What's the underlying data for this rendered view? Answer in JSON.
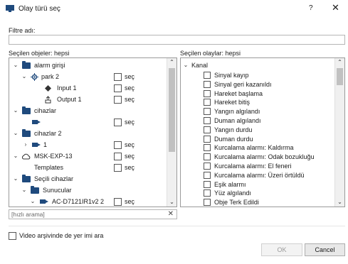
{
  "window": {
    "title": "Olay türü seç",
    "help": "?",
    "close": "✕"
  },
  "filter": {
    "label": "Filtre adı:",
    "value": ""
  },
  "objects": {
    "label": "Seçilen objeler: hepsi",
    "check_label": "seç",
    "items": [
      {
        "label": "alarm girişi",
        "icon": "folder-icon",
        "expand": "collapse"
      },
      {
        "label": "park 2",
        "icon": "alarm-sensor-icon",
        "expand": "collapse",
        "checkbox": true
      },
      {
        "label": "Input 1",
        "icon": "input-icon",
        "checkbox": true
      },
      {
        "label": "Output 1",
        "icon": "output-icon",
        "checkbox": true
      },
      {
        "label": "cihazlar",
        "icon": "folder-icon",
        "expand": "collapse"
      },
      {
        "label": "",
        "icon": "camera-icon",
        "checkbox": true
      },
      {
        "label": "cihazlar 2",
        "icon": "folder-icon",
        "expand": "collapse"
      },
      {
        "label": "1",
        "icon": "camera-icon",
        "expand": "expand",
        "checkbox": true
      },
      {
        "label": "MSK-EXP-13",
        "icon": "cloud-icon",
        "expand": "collapse",
        "checkbox": true
      },
      {
        "label": "Templates",
        "icon": "",
        "checkbox": true
      },
      {
        "label": "Seçili cihazlar",
        "icon": "folder-icon",
        "expand": "collapse"
      },
      {
        "label": "Sunucular",
        "icon": "folder-icon",
        "expand": "collapse"
      },
      {
        "label": "AC-D7121IR1v2 2",
        "icon": "camera-icon",
        "expand": "collapse",
        "checkbox": true
      }
    ]
  },
  "events": {
    "label": "Seçilen olaylar: hepsi",
    "group": "Kanal",
    "items": [
      "Sinyal kayıp",
      "Sinyal geri kazanıldı",
      "Hareket başlama",
      "Hareket bitiş",
      "Yangın algılandı",
      "Duman algılandı",
      "Yangın durdu",
      "Duman durdu",
      "Kurcalama alarmı: Kaldırma",
      "Kurcalama alarmı: Odak bozukluğu",
      "Kurcalama alarmı: El feneri",
      "Kurcalama alarmı: Üzeri örtüldü",
      "Eşik alarmı",
      "Yüz algılandı",
      "Obje Terk Edildi"
    ]
  },
  "quick_search": {
    "placeholder": "[hızlı arama]",
    "clear": "✕"
  },
  "archive_search": {
    "label": "Video arşivinde de yer imi ara",
    "checked": false
  },
  "buttons": {
    "ok": "OK",
    "cancel": "Cancel"
  },
  "colors": {
    "icon_blue": "#1f4a7d",
    "border": "#9a9a9a",
    "disabled_text": "#9a9a9a"
  }
}
